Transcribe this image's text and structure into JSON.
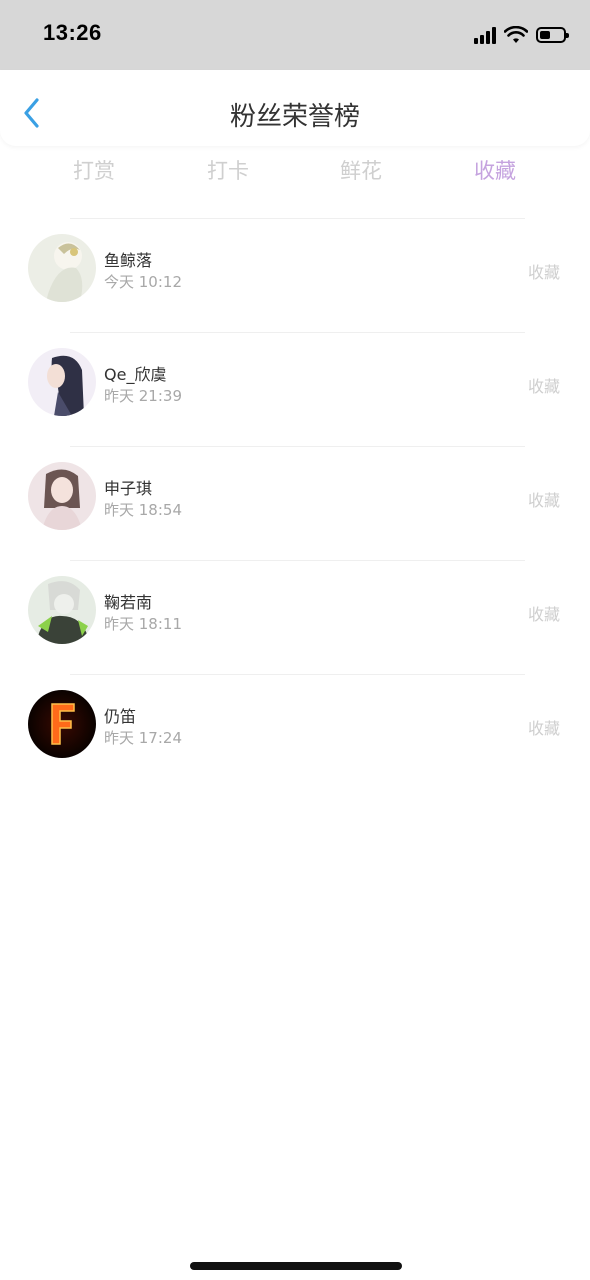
{
  "status_bar": {
    "time": "13:26"
  },
  "header": {
    "title": "粉丝荣誉榜"
  },
  "tabs": [
    {
      "label": "打赏"
    },
    {
      "label": "打卡"
    },
    {
      "label": "鲜花"
    },
    {
      "label": "收藏"
    }
  ],
  "active_tab": "收藏",
  "colors": {
    "active_tab": "#c5a3df",
    "back_icon": "#3aa0e4"
  },
  "fans": [
    {
      "name": "鱼鲸落",
      "time": "今天 10:12",
      "action": "收藏"
    },
    {
      "name": "Qe_欣虞",
      "time": "昨天 21:39",
      "action": "收藏"
    },
    {
      "name": "申子琪",
      "time": "昨天 18:54",
      "action": "收藏"
    },
    {
      "name": "鞠若南",
      "time": "昨天 18:11",
      "action": "收藏"
    },
    {
      "name": "仍笛",
      "time": "昨天 17:24",
      "action": "收藏"
    }
  ]
}
